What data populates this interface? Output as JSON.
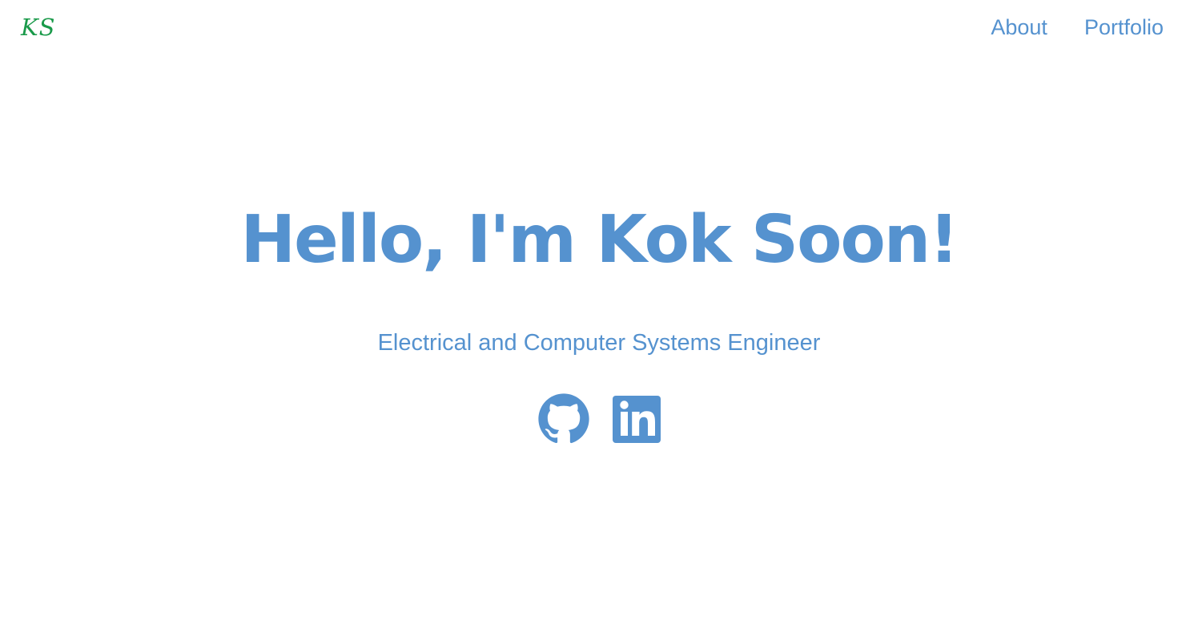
{
  "header": {
    "logo_text": "KS",
    "nav": [
      {
        "label": "About"
      },
      {
        "label": "Portfolio"
      }
    ]
  },
  "hero": {
    "title": "Hello, I'm Kok Soon!",
    "subtitle": "Electrical and Computer Systems Engineer"
  },
  "social_links": [
    {
      "icon": "github-icon"
    },
    {
      "icon": "linkedin-icon"
    }
  ],
  "colors": {
    "accent": "#5592cf",
    "logo": "#1a9a4a",
    "background": "#ffffff"
  }
}
